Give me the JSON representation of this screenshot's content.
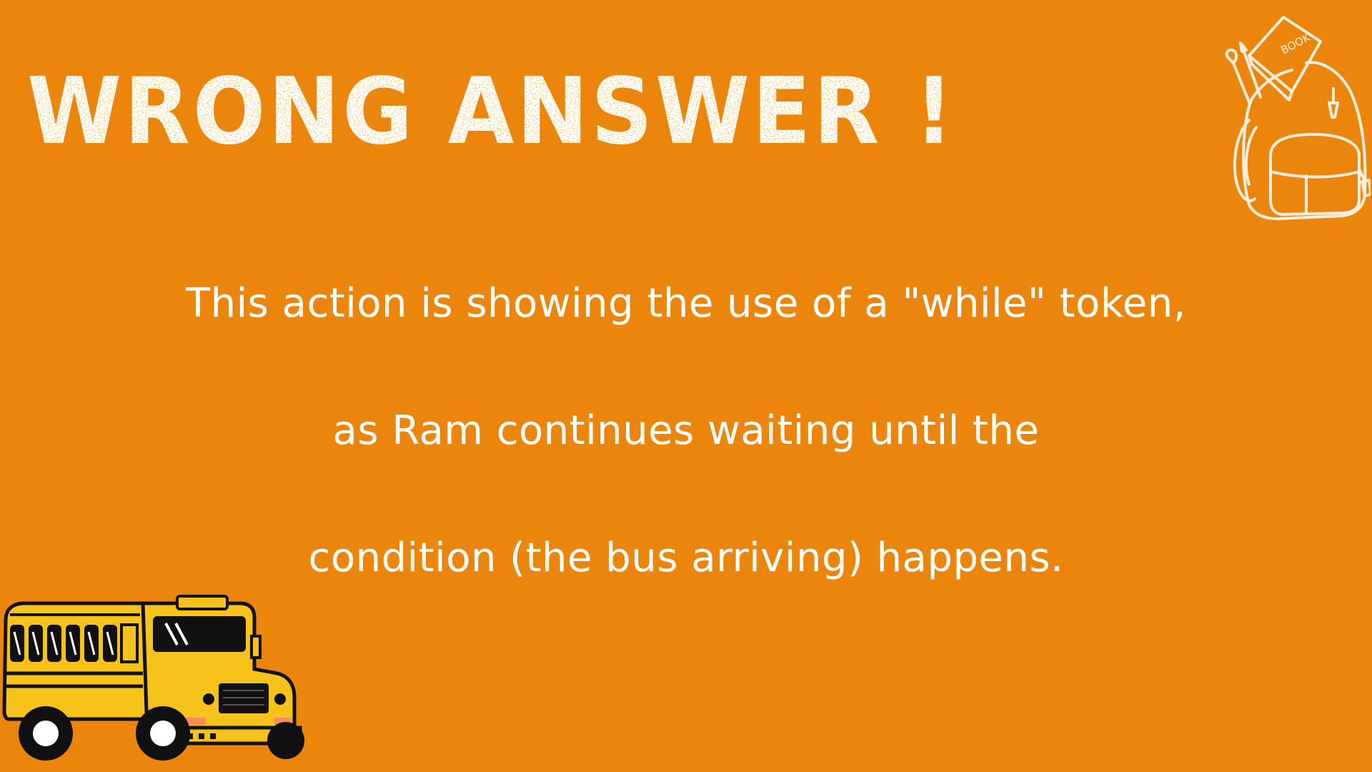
{
  "slide": {
    "background_color": "#ec850b",
    "headline": "WRONG ANSWER !",
    "body_lines": [
      "This action is showing  the use of a \"while\" token,",
      "as Ram continues waiting until the",
      "condition (the bus arriving) happens."
    ]
  },
  "decorations": {
    "backpack": {
      "icon": "backpack-icon",
      "book_label": "BOOK"
    },
    "bus": {
      "icon": "school-bus-icon",
      "color": "#f7c31a"
    }
  }
}
